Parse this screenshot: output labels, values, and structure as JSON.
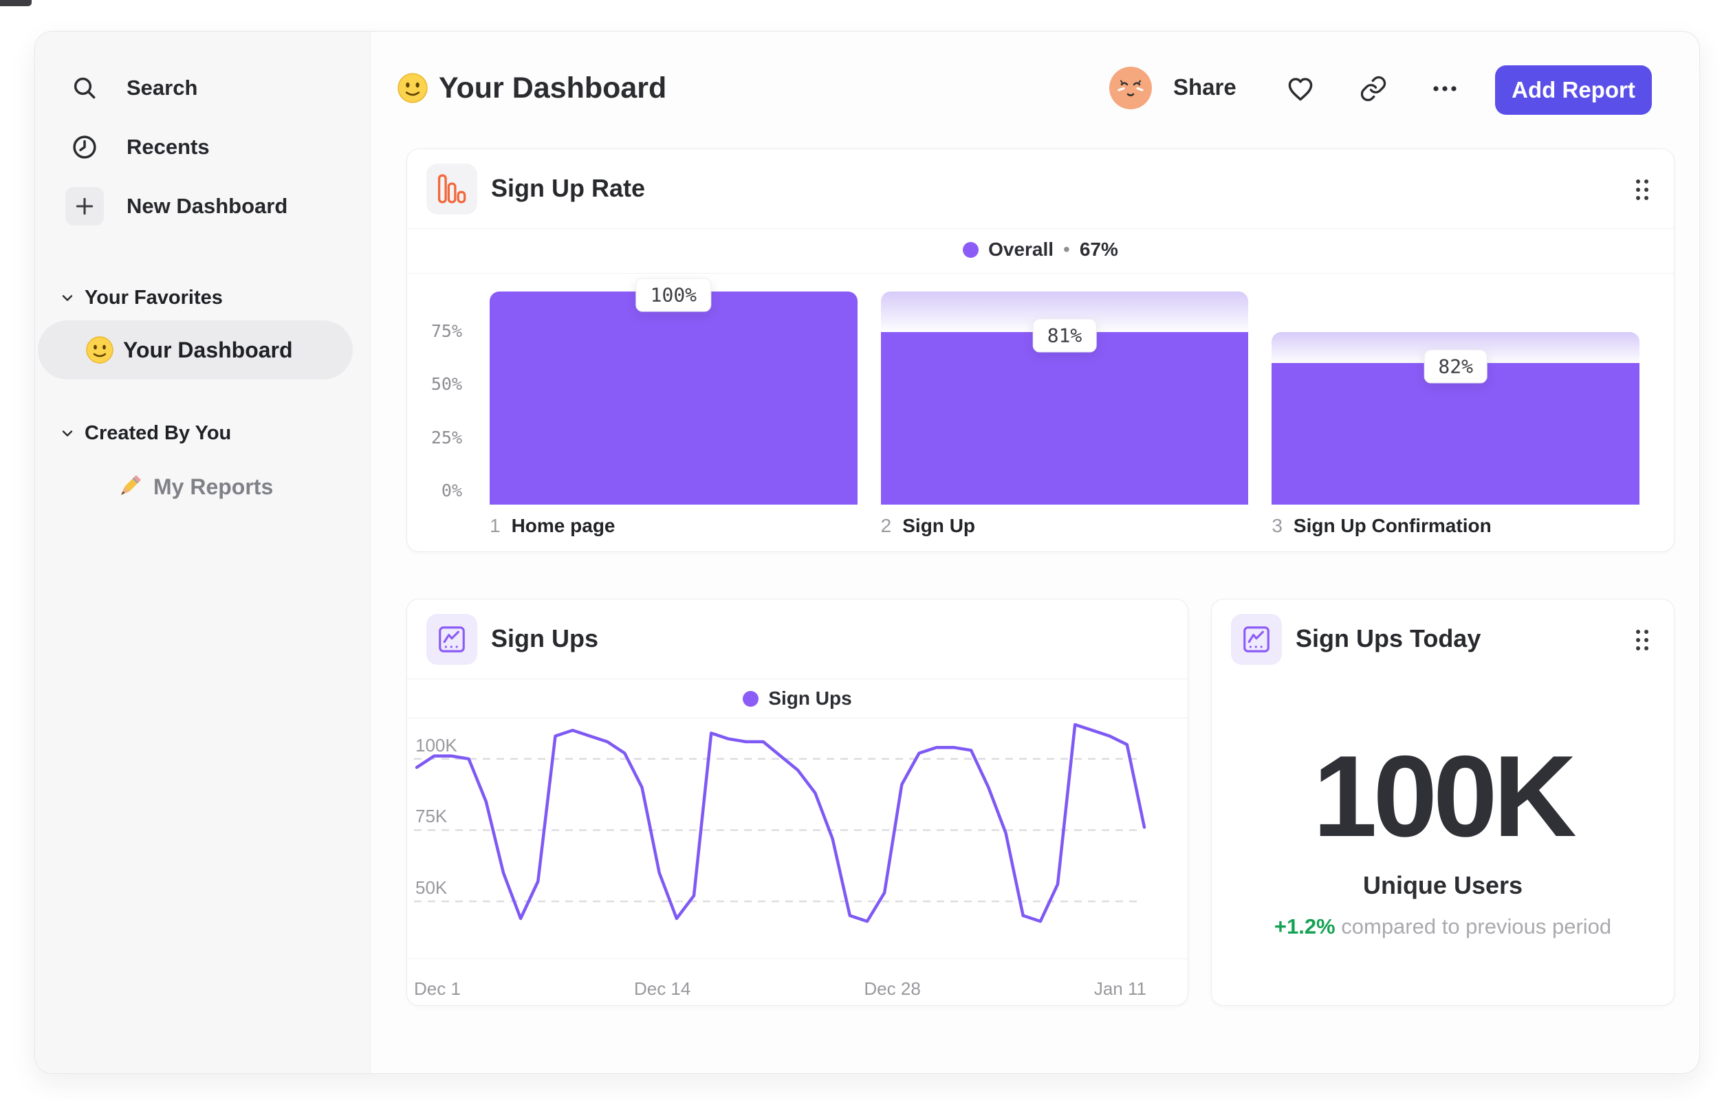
{
  "colors": {
    "accent": "#5B4FE9",
    "series_purple": "#8A5CF7",
    "legend_dot_purple": "#8B5CF6",
    "ghost_purple_top": "#D6CBF9",
    "line_purple": "#7E59F4",
    "positive_green": "#15A254",
    "icon_orange": "#F2683C",
    "icon_purple": "#8B5CF6"
  },
  "icons": {
    "sidebar": [
      "search-icon",
      "clock-icon",
      "plus-icon",
      "chevron-down-icon"
    ],
    "header": [
      "smiley-emoji",
      "relieved-face-avatar",
      "heart-icon",
      "link-icon",
      "more-ellipsis-icon"
    ],
    "cards": [
      "bar-chart-icon",
      "line-chart-icon",
      "drag-handle-icon"
    ],
    "sidebar_emojis": [
      "slightly-smiling-face",
      "pencil"
    ]
  },
  "sidebar": {
    "nav": [
      {
        "label": "Search"
      },
      {
        "label": "Recents"
      },
      {
        "label": "New Dashboard"
      }
    ],
    "sections": [
      {
        "title": "Your Favorites",
        "items": [
          {
            "label": "Your Dashboard",
            "active": true
          }
        ]
      },
      {
        "title": "Created By You",
        "items": [
          {
            "label": "My Reports",
            "active": false
          }
        ]
      }
    ]
  },
  "header": {
    "title": "Your Dashboard",
    "share": "Share",
    "add_report": "Add Report"
  },
  "cards": {
    "sign_up_rate": {
      "title": "Sign Up Rate",
      "legend": {
        "label": "Overall",
        "separator": "•",
        "value": "67%"
      }
    },
    "sign_ups": {
      "title": "Sign Ups",
      "legend": "Sign Ups"
    },
    "sign_ups_today": {
      "title": "Sign Ups Today",
      "value": "100K",
      "value_label": "Unique Users",
      "delta": "+1.2%",
      "delta_caption": "compared to previous period"
    }
  },
  "chart_data": [
    {
      "type": "bar",
      "subtype": "funnel",
      "title": "Sign Up Rate",
      "legend": [
        {
          "label": "Overall",
          "value": "67%",
          "color": "#8B5CF6"
        }
      ],
      "legend_position": "top-center",
      "categories": [
        "Home page",
        "Sign Up",
        "Sign Up Confirmation"
      ],
      "step_indices": [
        "1",
        "2",
        "3"
      ],
      "step_conversion_pct": [
        100,
        81,
        82
      ],
      "bar_labels": [
        "100%",
        "81%",
        "82%"
      ],
      "y_ticks": [
        {
          "label": "75%",
          "value": 75
        },
        {
          "label": "50%",
          "value": 50
        },
        {
          "label": "25%",
          "value": 25
        },
        {
          "label": "0%",
          "value": 0
        }
      ],
      "ylim": [
        0,
        100
      ],
      "grid": false
    },
    {
      "type": "line",
      "title": "Sign Ups",
      "legend": [
        {
          "label": "Sign Ups",
          "color": "#8B5CF6"
        }
      ],
      "legend_position": "top-center",
      "x_tick_labels": [
        "Dec 1",
        "Dec 14",
        "Dec 28",
        "Jan 11"
      ],
      "x_tick_days": [
        0,
        13,
        27,
        41
      ],
      "x_span_days": 42,
      "y_ticks": [
        {
          "label": "100K",
          "value": 100
        },
        {
          "label": "75K",
          "value": 75
        },
        {
          "label": "50K",
          "value": 50
        }
      ],
      "ylim_k": [
        30,
        112
      ],
      "grid": "dashed-horizontal",
      "values_k": [
        97,
        101,
        101,
        100,
        85,
        60,
        44,
        57,
        108,
        110,
        108,
        106,
        102,
        90,
        60,
        44,
        52,
        109,
        107,
        106,
        106,
        101,
        96,
        88,
        72,
        45,
        43,
        53,
        91,
        102,
        104,
        104,
        103,
        90,
        74,
        45,
        43,
        56,
        112,
        110,
        108,
        105,
        76
      ]
    }
  ]
}
